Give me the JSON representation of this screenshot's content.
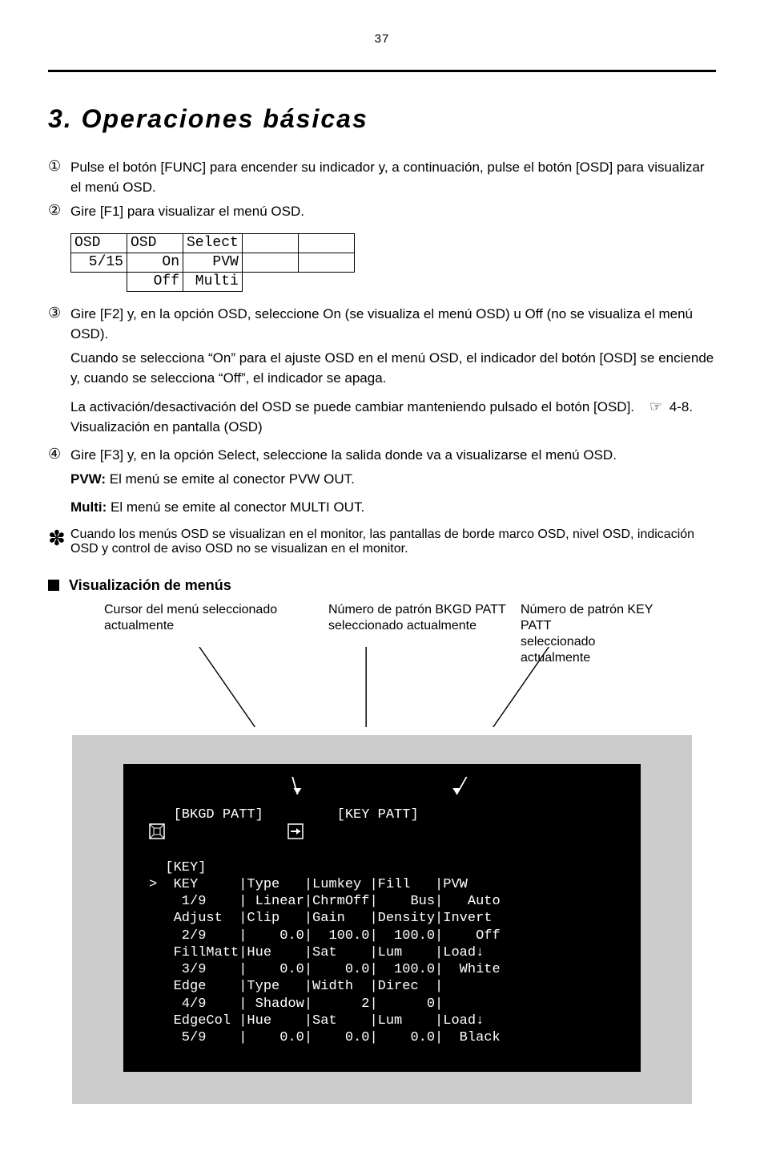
{
  "page_number": "37",
  "title": "3. Operaciones básicas",
  "steps": {
    "1": "Pulse el botón [FUNC] para encender su indicador y, a continuación, pulse el botón [OSD] para visualizar el menú OSD.",
    "2": "Gire [F1] para visualizar el menú OSD."
  },
  "osd_table": {
    "row1": {
      "c1": "OSD",
      "c2": "OSD",
      "c3": "Select",
      "c4": "",
      "c5": ""
    },
    "row2": {
      "c1": "5/15",
      "c2": "On",
      "c3": "PVW",
      "c4": "",
      "c5": ""
    },
    "row3": {
      "c2": "Off",
      "c3": "Multi"
    }
  },
  "step3": {
    "first": "Gire [F2] y, en la opción OSD, seleccione On (se visualiza el menú OSD) u Off (no se visualiza el menú OSD).",
    "second": "Cuando se selecciona “On” para el ajuste OSD en el menú OSD, el indicador del botón [OSD] se enciende y, cuando se selecciona “Off”, el indicador se apaga.",
    "third": "La activación/desactivación del OSD se puede cambiar manteniendo pulsado el botón [OSD].",
    "link_prefix": "☞",
    "link": "4-8. Visualización en pantalla (OSD)"
  },
  "step4": {
    "first": "Gire [F3] y, en la opción Select, seleccione la salida donde va a visualizarse el menú OSD.",
    "pvw_label": "PVW:",
    "pvw_text": " El menú se emite al conector PVW OUT.",
    "multi_label": "Multi:",
    "multi_text": " El menú se emite al conector MULTI OUT."
  },
  "note": {
    "star": "✽",
    "text": "Cuando los menús OSD se visualizan en el monitor, las pantallas de borde marco OSD, nivel OSD, indicación OSD y control de aviso OSD no se visualizan en el monitor."
  },
  "sub_heading": "Visualización de menús",
  "callouts": {
    "cursor": "Cursor del menú seleccionado\nactualmente",
    "bkgd": "Número de patrón BKGD PATT\nseleccionado actualmente",
    "key": "Número de patrón KEY PATT\nseleccionado actualmente"
  },
  "osd_screen": {
    "header": "   [BKGD PATT]         [KEY PATT]    ",
    "lines": [
      "  [KEY]",
      "  KEY     |Type   |Lumkey |Fill   |PVW",
      "   1/9    | Linear|ChrmOff|    Bus|   Auto",
      "  Adjust  |Clip   |Gain   |Density|Invert",
      "   2/9    |    0.0|  100.0|  100.0|    Off",
      "  FillMatt|Hue    |Sat    |Lum    |Load↓",
      "   3/9    |    0.0|    0.0|  100.0|  White",
      "  Edge    |Type   |Width  |Direc  |",
      "   4/9    | Shadow|      2|      0|",
      "  EdgeCol |Hue    |Sat    |Lum    |Load↓",
      "   5/9    |    0.0|    0.0|    0.0|  Black"
    ]
  }
}
